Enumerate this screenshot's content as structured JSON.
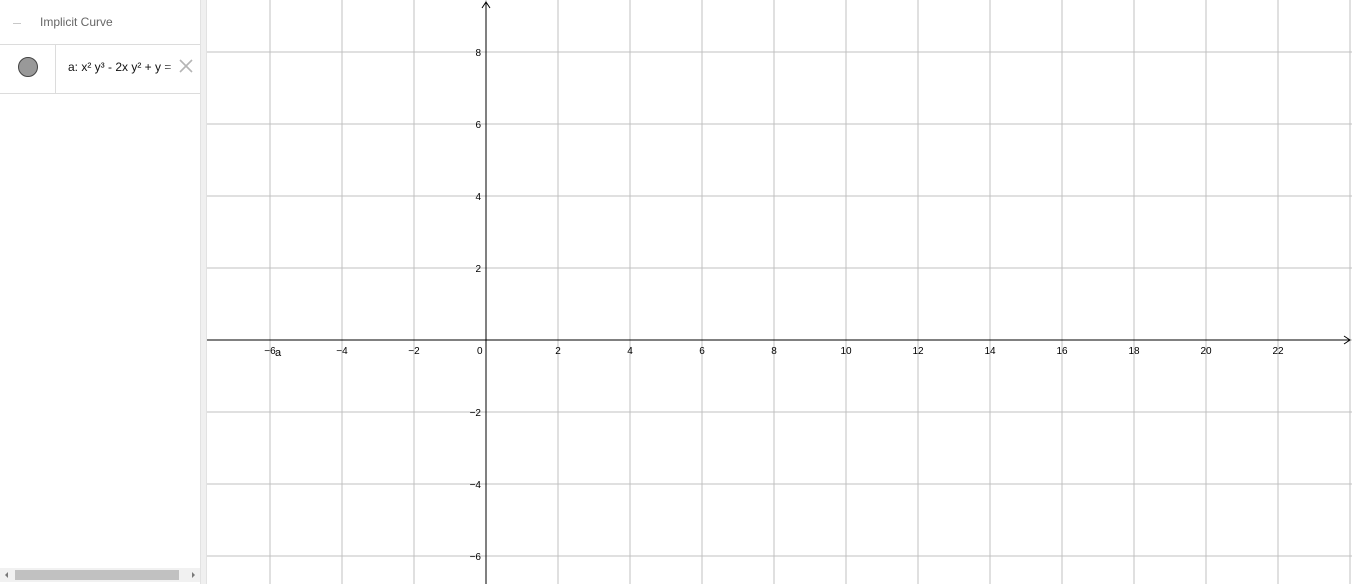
{
  "algebra": {
    "category_title": "Implicit Curve",
    "object": {
      "definition": "a: x² y³ - 2x y² + y ="
    }
  },
  "graphics": {
    "axes": {
      "x_ticks": [
        "−6",
        "−4",
        "−2",
        "0",
        "2",
        "4",
        "6",
        "8",
        "10",
        "12",
        "14",
        "16",
        "18",
        "20",
        "22"
      ],
      "y_ticks": [
        "8",
        "6",
        "4",
        "2",
        "−2",
        "−4",
        "−6"
      ],
      "grid": true
    },
    "curve_label": "a"
  },
  "colors": {
    "grid": "#c0c0c0",
    "axis": "#000000",
    "marble": "#999999"
  }
}
